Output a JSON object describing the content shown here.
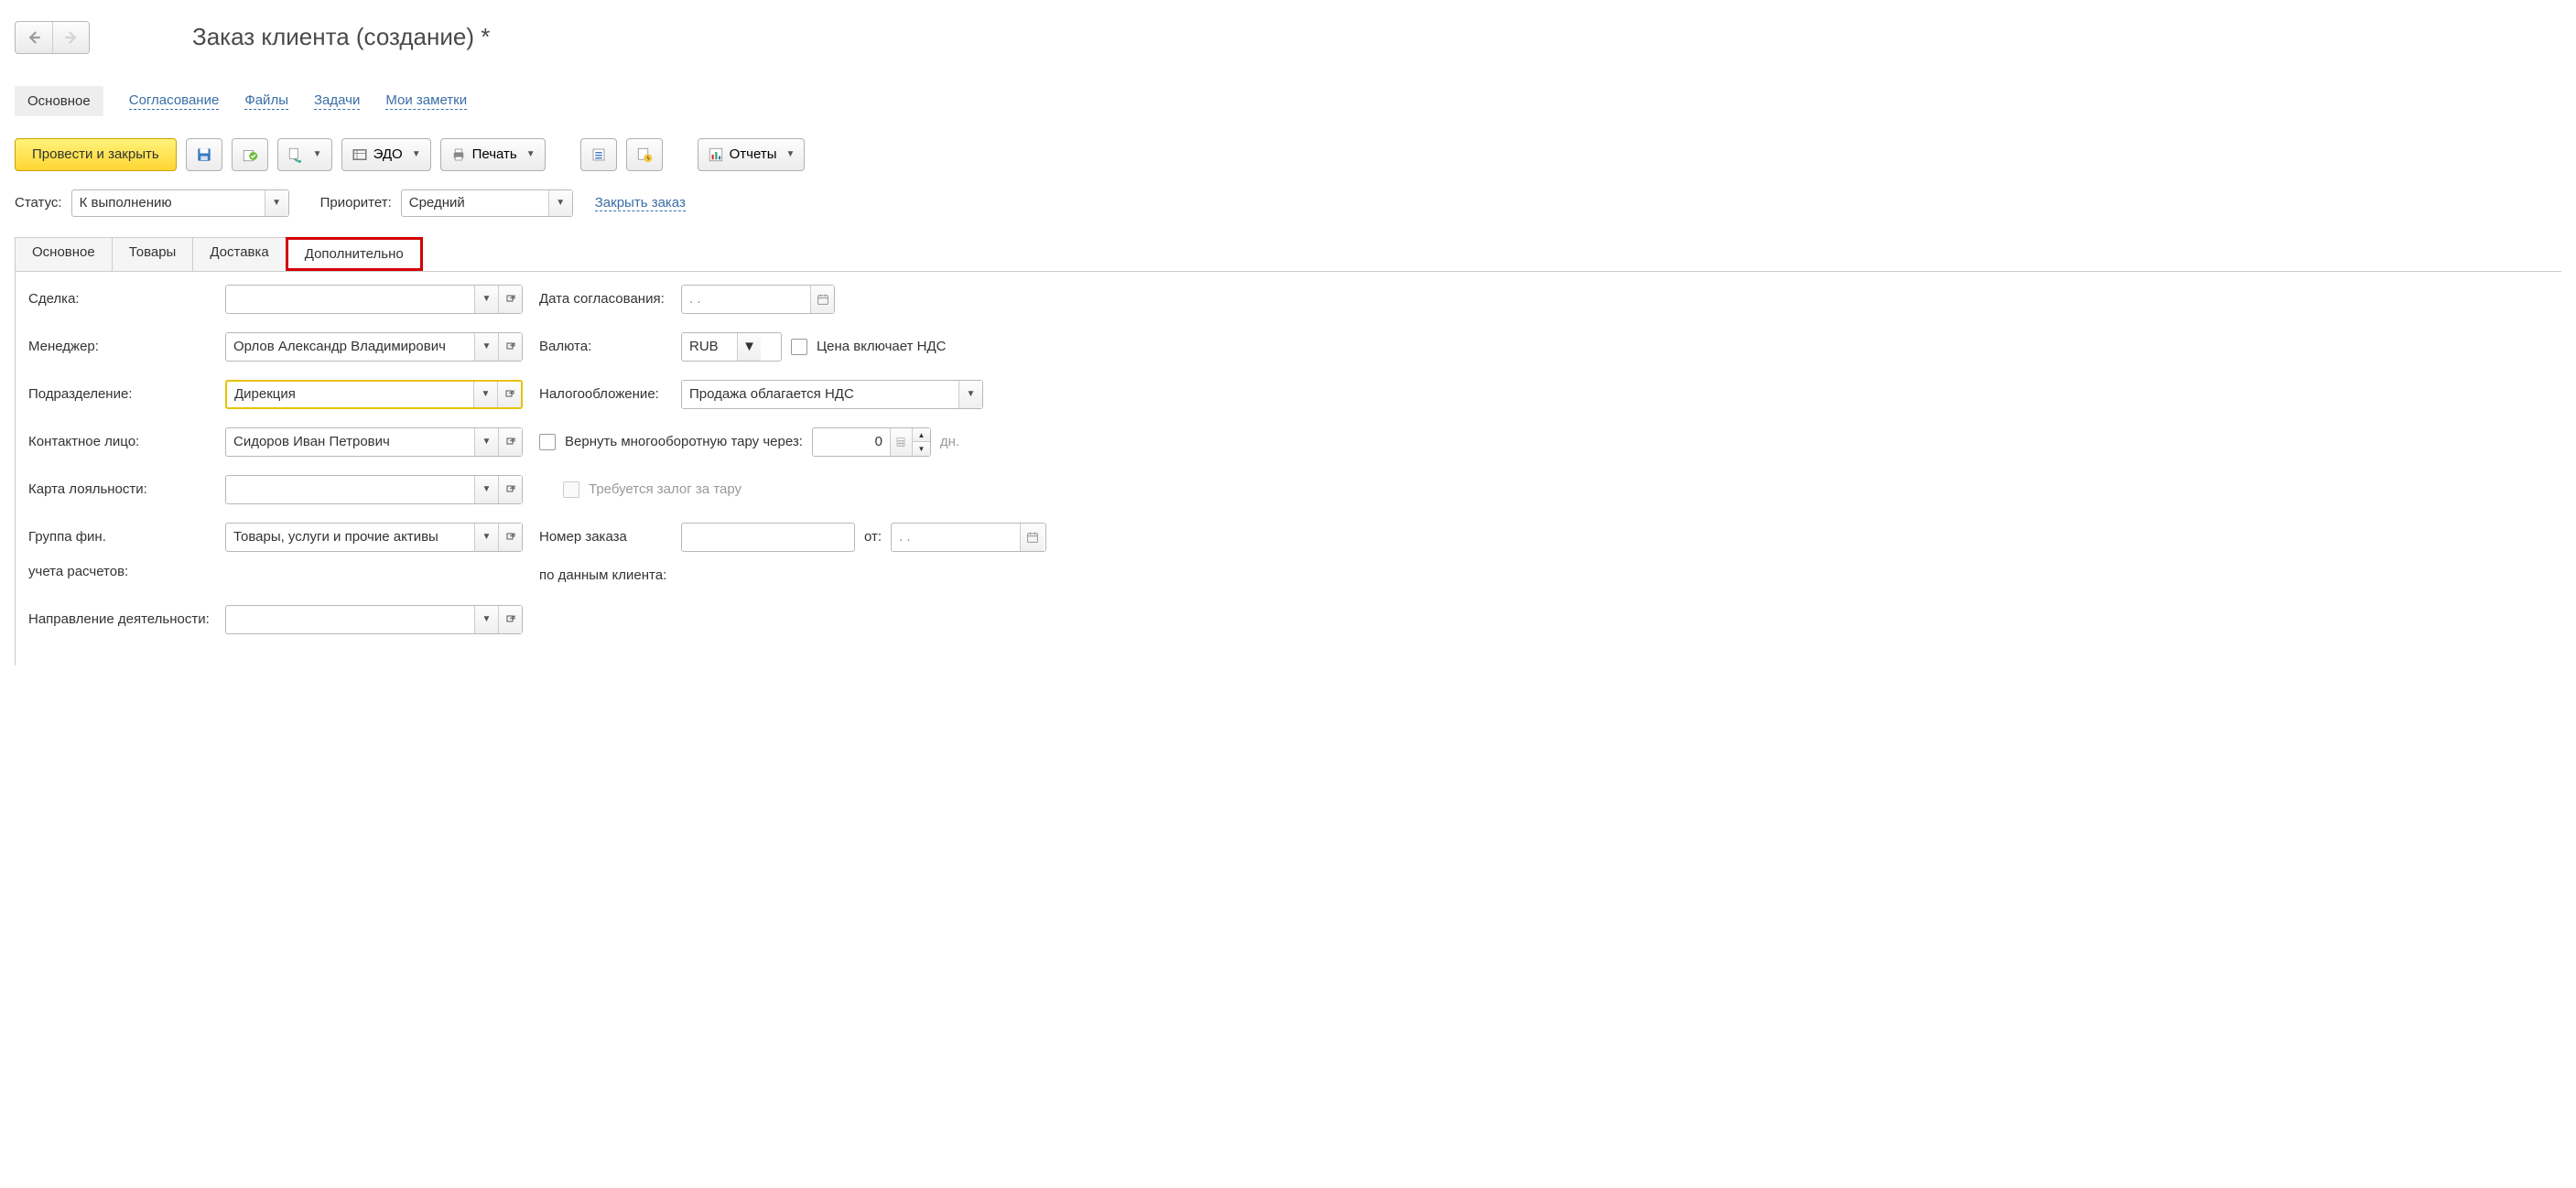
{
  "header": {
    "title": "Заказ клиента (создание) *"
  },
  "sections": {
    "main": "Основное",
    "approval": "Согласование",
    "files": "Файлы",
    "tasks": "Задачи",
    "notes": "Мои заметки"
  },
  "toolbar": {
    "post_close": "Провести и закрыть",
    "edo": "ЭДО",
    "print": "Печать",
    "reports": "Отчеты"
  },
  "status_row": {
    "status_label": "Статус:",
    "status_value": "К выполнению",
    "priority_label": "Приоритет:",
    "priority_value": "Средний",
    "close_order": "Закрыть заказ"
  },
  "tabs": {
    "main": "Основное",
    "goods": "Товары",
    "delivery": "Доставка",
    "additional": "Дополнительно"
  },
  "form": {
    "deal_label": "Сделка:",
    "deal_value": "",
    "manager_label": "Менеджер:",
    "manager_value": "Орлов Александр Владимирович",
    "dept_label": "Подразделение:",
    "dept_value": "Дирекция",
    "contact_label": "Контактное лицо:",
    "contact_value": "Сидоров Иван Петрович",
    "loyalty_label": "Карта лояльности:",
    "loyalty_value": "",
    "fingroup_label1": "Группа фин.",
    "fingroup_label2": "учета расчетов:",
    "fingroup_value": "Товары, услуги и прочие активы",
    "activity_label": "Направление деятельности:",
    "activity_value": ""
  },
  "right": {
    "approval_date_label": "Дата согласования:",
    "approval_date_value": ".  .",
    "currency_label": "Валюта:",
    "currency_value": "RUB",
    "price_includes_vat": "Цена включает НДС",
    "taxation_label": "Налогообложение:",
    "taxation_value": "Продажа облагается НДС",
    "return_tare_label": "Вернуть многооборотную тару через:",
    "return_tare_value": "0",
    "days_label": "дн.",
    "deposit_label": "Требуется залог за тару",
    "order_num_label": "Номер заказа",
    "order_num_label2": "по данным клиента:",
    "from_label": "от:",
    "from_value": ".  ."
  }
}
